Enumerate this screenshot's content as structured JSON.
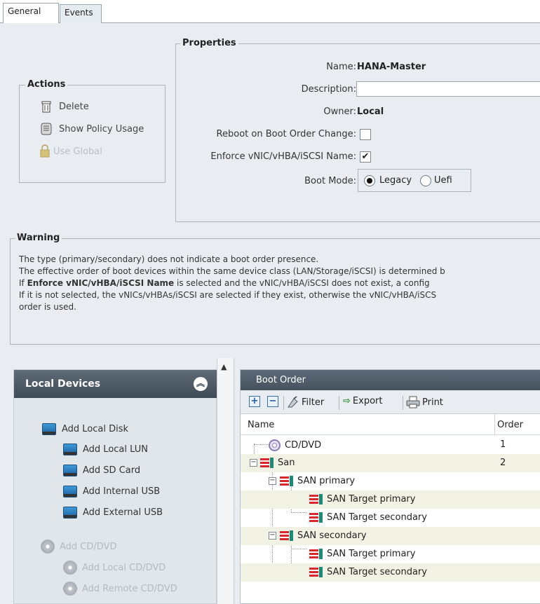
{
  "tabs": [
    {
      "label": "General"
    },
    {
      "label": "Events"
    }
  ],
  "actions": {
    "title": "Actions",
    "items": [
      {
        "label": "Delete",
        "icon": "trash-icon"
      },
      {
        "label": "Show Policy Usage",
        "icon": "scroll-icon"
      },
      {
        "label": "Use Global",
        "icon": "lock-icon"
      }
    ]
  },
  "properties": {
    "title": "Properties",
    "name_label": "Name:",
    "name_value": "HANA-Master",
    "description_label": "Description:",
    "description_value": "",
    "owner_label": "Owner:",
    "owner_value": "Local",
    "reboot_label": "Reboot on Boot Order Change:",
    "reboot_checked": false,
    "enforce_label": "Enforce vNIC/vHBA/iSCSI Name:",
    "enforce_checked": true,
    "bootmode_label": "Boot Mode:",
    "bootmode_options": [
      "Legacy",
      "Uefi"
    ],
    "bootmode_selected": "Legacy"
  },
  "warning": {
    "title": "Warning",
    "line1": "The type (primary/secondary) does not indicate a boot order presence.",
    "line2": "The effective order of boot devices within the same device class (LAN/Storage/iSCSI) is determined b",
    "line3_prefix": "If ",
    "line3_bold": "Enforce vNIC/vHBA/iSCSI Name",
    "line3_suffix": " is selected and the vNIC/vHBA/iSCSI does not exist, a config",
    "line4": "If it is not selected, the vNICs/vHBAs/iSCSI are selected if they exist, otherwise the vNIC/vHBA/iSCS",
    "line5": "order is used."
  },
  "local_devices": {
    "title": "Local Devices",
    "items": [
      {
        "label": "Add Local Disk",
        "enabled": true
      },
      {
        "label": "Add Local LUN",
        "enabled": true
      },
      {
        "label": "Add SD Card",
        "enabled": true
      },
      {
        "label": "Add Internal USB",
        "enabled": true
      },
      {
        "label": "Add External USB",
        "enabled": true
      },
      {
        "label": "Add CD/DVD",
        "enabled": false
      },
      {
        "label": "Add Local CD/DVD",
        "enabled": false
      },
      {
        "label": "Add Remote CD/DVD",
        "enabled": false
      }
    ]
  },
  "boot_order": {
    "title": "Boot Order",
    "toolbar": {
      "filter": "Filter",
      "export": "Export",
      "print": "Print"
    },
    "columns": {
      "name": "Name",
      "order": "Order"
    },
    "rows": [
      {
        "name": "CD/DVD",
        "order": "1"
      },
      {
        "name": "San",
        "order": "2"
      },
      {
        "name": "SAN primary",
        "order": ""
      },
      {
        "name": "SAN Target primary",
        "order": ""
      },
      {
        "name": "SAN Target secondary",
        "order": ""
      },
      {
        "name": "SAN secondary",
        "order": ""
      },
      {
        "name": "SAN Target primary",
        "order": ""
      },
      {
        "name": "SAN Target secondary",
        "order": ""
      }
    ]
  }
}
